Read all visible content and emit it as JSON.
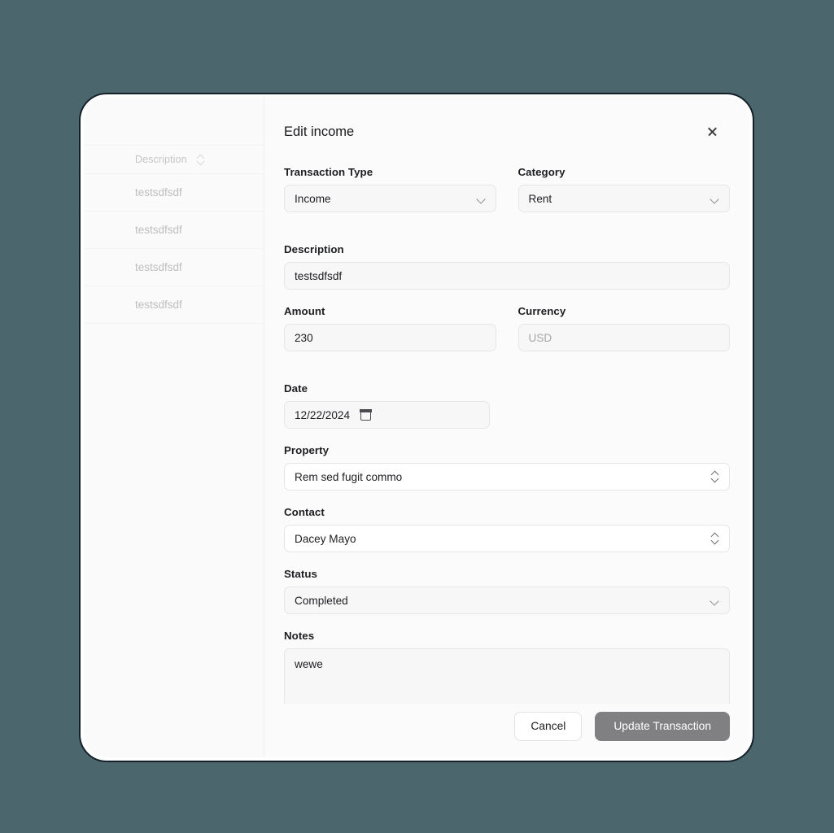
{
  "background": {
    "color": "#4c666d"
  },
  "sidebar": {
    "column_header": {
      "label": "Description",
      "sort_icon": "sort-updown-icon"
    },
    "rows": [
      {
        "description": "testsdfsdf"
      },
      {
        "description": "testsdfsdf"
      },
      {
        "description": "testsdfsdf"
      },
      {
        "description": "testsdfsdf"
      }
    ]
  },
  "modal": {
    "title": "Edit income",
    "close_icon": "close-icon",
    "fields": {
      "transaction_type": {
        "label": "Transaction Type",
        "value": "Income",
        "icon": "chevron-down-icon"
      },
      "category": {
        "label": "Category",
        "value": "Rent",
        "icon": "chevron-down-icon"
      },
      "description": {
        "label": "Description",
        "value": "testsdfsdf",
        "placeholder": ""
      },
      "amount": {
        "label": "Amount",
        "value": "230",
        "placeholder": ""
      },
      "currency": {
        "label": "Currency",
        "value": "",
        "placeholder": "USD"
      },
      "date": {
        "label": "Date",
        "value": "12/22/2024",
        "icon": "calendar-icon"
      },
      "property": {
        "label": "Property",
        "value": "Rem sed fugit commo",
        "icon": "chevron-updown-icon"
      },
      "contact": {
        "label": "Contact",
        "value": "Dacey Mayo",
        "icon": "chevron-updown-icon"
      },
      "status": {
        "label": "Status",
        "value": "Completed",
        "icon": "chevron-down-icon"
      },
      "notes": {
        "label": "Notes",
        "value": "wewe",
        "placeholder": ""
      }
    },
    "footer": {
      "cancel_label": "Cancel",
      "submit_label": "Update Transaction",
      "submit_color": "#808083"
    }
  }
}
